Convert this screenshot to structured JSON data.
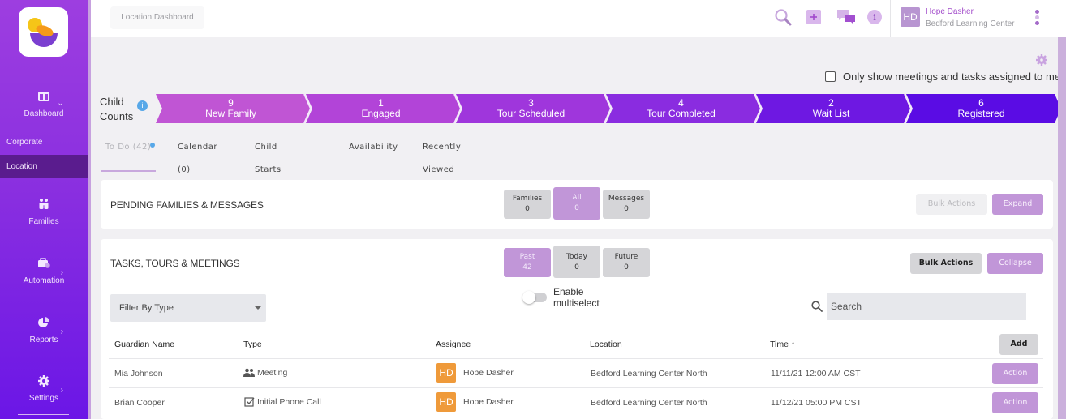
{
  "sidebar": {
    "logo": "app-logo",
    "items": [
      {
        "label": "Dashboard",
        "icon": "dashboard-icon",
        "has_submenu": true,
        "expanded": true
      },
      {
        "label": "Families",
        "icon": "families-icon",
        "has_submenu": false
      },
      {
        "label": "Automation",
        "icon": "briefcase-icon",
        "has_submenu": true
      },
      {
        "label": "Reports",
        "icon": "pie-chart-icon",
        "has_submenu": true
      },
      {
        "label": "Settings",
        "icon": "gear-icon",
        "has_submenu": true
      }
    ],
    "dashboard_sub": [
      {
        "label": "Corporate",
        "active": false
      },
      {
        "label": "Location",
        "active": true
      }
    ]
  },
  "topbar": {
    "breadcrumb": "Location Dashboard",
    "icons": [
      "search-icon",
      "add-icon",
      "chat-icon",
      "info-icon"
    ],
    "user": {
      "initials": "HD",
      "name": "Hope Dasher",
      "location": "Bedford Learning Center"
    }
  },
  "filter_assigned": {
    "label": "Only show meetings and tasks assigned to me",
    "checked": false
  },
  "child_counts": {
    "label_line1": "Child",
    "label_line2": "Counts",
    "info": "i",
    "stages": [
      {
        "count": "9",
        "label": "New Family",
        "color": "#c055d4"
      },
      {
        "count": "1",
        "label": "Engaged",
        "color": "#b244d8"
      },
      {
        "count": "3",
        "label": "Tour Scheduled",
        "color": "#9f36dc"
      },
      {
        "count": "4",
        "label": "Tour Completed",
        "color": "#8a2ce0"
      },
      {
        "count": "2",
        "label": "Wait List",
        "color": "#6e18e2"
      },
      {
        "count": "6",
        "label": "Registered",
        "color": "#5a0ce4"
      }
    ]
  },
  "tabs": [
    {
      "label": "To Do (42)",
      "active": true,
      "dot": true
    },
    {
      "label": "Calendar (0)",
      "active": false
    },
    {
      "label": "Child Starts (0)",
      "active": false
    },
    {
      "label": "Availability",
      "active": false
    },
    {
      "label": "Recently Viewed",
      "active": false
    }
  ],
  "pending": {
    "title": "PENDING FAMILIES & MESSAGES",
    "segments": [
      {
        "label": "Families",
        "count": "0",
        "active": false
      },
      {
        "label": "All",
        "count": "0",
        "active": true
      },
      {
        "label": "Messages",
        "count": "0",
        "active": false
      }
    ],
    "bulk_actions": "Bulk Actions",
    "expand": "Expand"
  },
  "tasks": {
    "title": "TASKS, TOURS & MEETINGS",
    "segments": [
      {
        "label": "Past",
        "count": "42",
        "active": true
      },
      {
        "label": "Today",
        "count": "0",
        "active": false
      },
      {
        "label": "Future",
        "count": "0",
        "active": false
      }
    ],
    "bulk_actions": "Bulk Actions",
    "collapse": "Collapse",
    "filter_placeholder": "Filter By Type",
    "multiselect_label_1": "Enable",
    "multiselect_label_2": "multiselect",
    "multiselect_on": false,
    "search_placeholder": "Search",
    "columns": [
      "Guardian Name",
      "Type",
      "Assignee",
      "Location",
      "Time ↑"
    ],
    "add_label": "Add",
    "rows": [
      {
        "guardian": "Mia Johnson",
        "type": "Meeting",
        "type_icon": "people-icon",
        "assignee_initials": "HD",
        "assignee": "Hope Dasher",
        "location": "Bedford Learning Center North",
        "time": "11/11/21 12:00 AM CST",
        "action": "Action"
      },
      {
        "guardian": "Brian Cooper",
        "type": "Initial Phone Call",
        "type_icon": "checkbox-icon",
        "assignee_initials": "HD",
        "assignee": "Hope Dasher",
        "location": "Bedford Learning Center North",
        "time": "11/12/21 05:00 PM CST",
        "action": "Action"
      }
    ]
  }
}
